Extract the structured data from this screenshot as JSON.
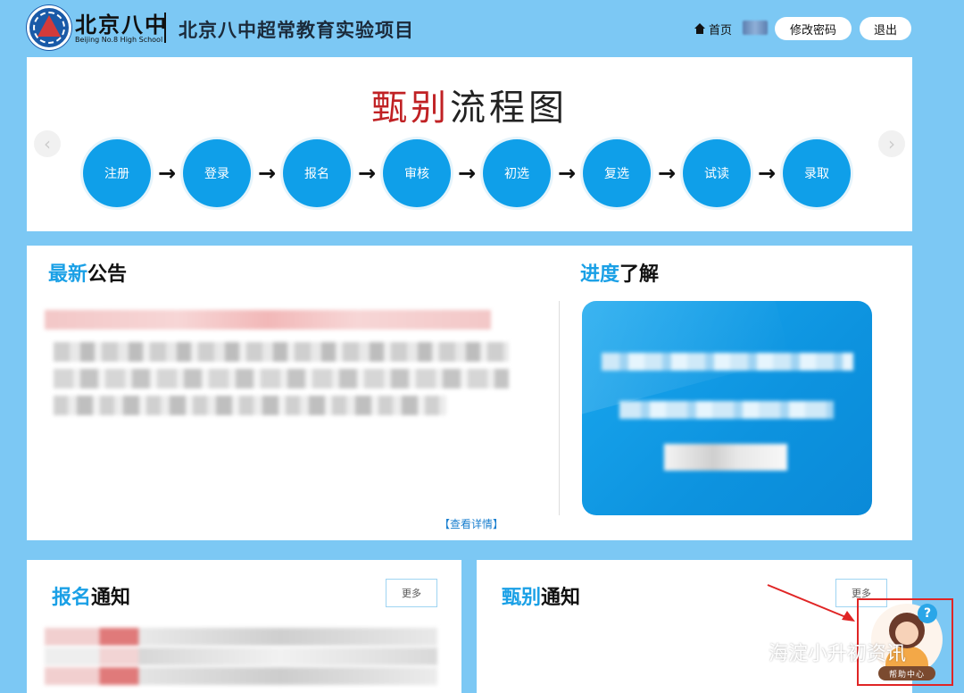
{
  "header": {
    "school_cn": "北京八中",
    "school_en": "Beijing No.8 High School",
    "project_title": "北京八中超常教育实验项目",
    "home_label": "首页",
    "change_password_label": "修改密码",
    "logout_label": "退出"
  },
  "flow": {
    "title_red": "甄别",
    "title_black": "流程图",
    "steps": [
      "注册",
      "登录",
      "报名",
      "审核",
      "初选",
      "复选",
      "试读",
      "录取"
    ],
    "arrow": "→"
  },
  "news": {
    "title_blue": "最新",
    "title_black": "公告",
    "detail_link": "【查看详情】"
  },
  "progress": {
    "title_blue": "进度",
    "title_black": "了解"
  },
  "registration_notice": {
    "title_blue": "报名",
    "title_black": "通知",
    "more_label": "更多"
  },
  "selection_notice": {
    "title_blue": "甄别",
    "title_black": "通知",
    "more_label": "更多"
  },
  "help": {
    "label": "帮助中心",
    "question_mark": "?"
  },
  "watermark": {
    "text": "海淀小升初资讯"
  },
  "colors": {
    "page_bg": "#7cc8f4",
    "step_blue": "#0f9fe9",
    "title_red": "#c02124",
    "accent_blue": "#1aa0e6",
    "highlight_red": "#e02525"
  }
}
